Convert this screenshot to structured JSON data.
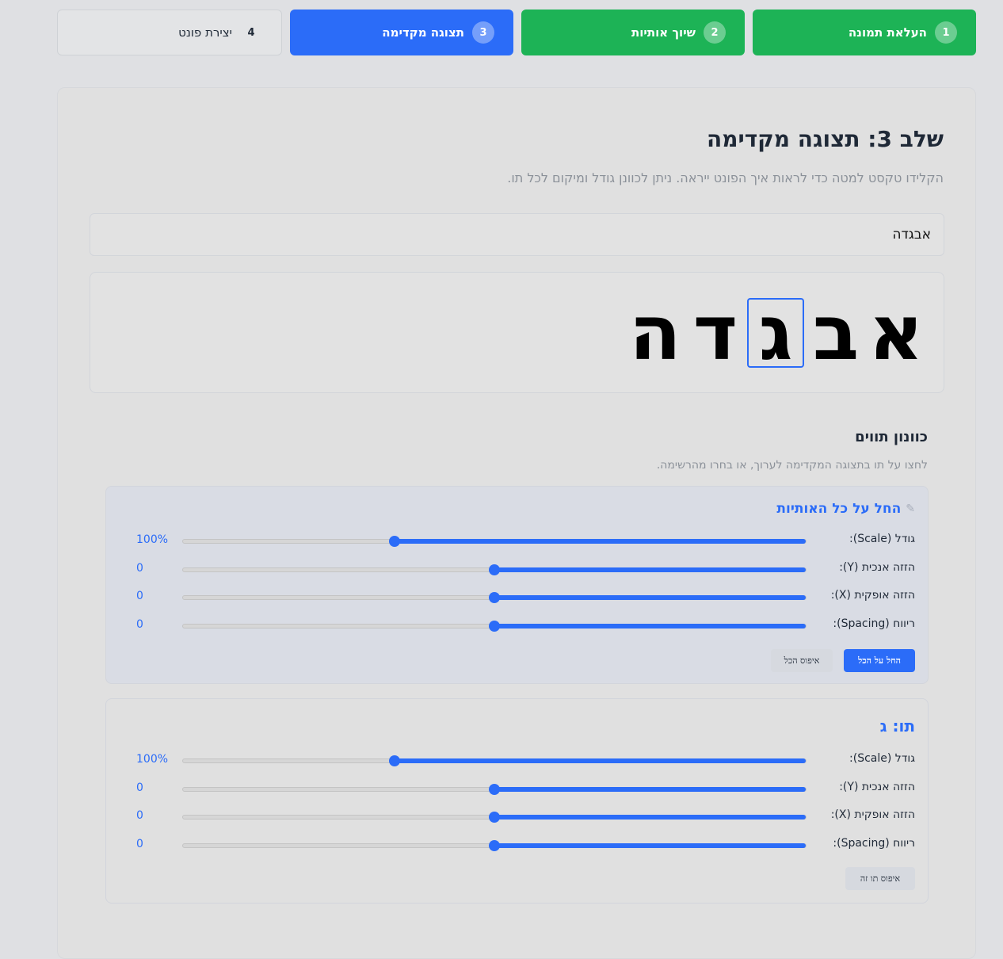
{
  "steps": [
    {
      "num": "1",
      "label": "העלאת תמונה",
      "state": "done"
    },
    {
      "num": "2",
      "label": "שיוך אותיות",
      "state": "done"
    },
    {
      "num": "3",
      "label": "תצוגה מקדימה",
      "state": "active"
    },
    {
      "num": "4",
      "label": "יצירת פונט",
      "state": "pending"
    }
  ],
  "main": {
    "title": "שלב 3: תצוגה מקדימה",
    "subtitle": "הקלידו טקסט למטה כדי לראות איך הפונט ייראה. ניתן לכוונן גודל ומיקום לכל תו.",
    "input_value": "אבגדה"
  },
  "preview": {
    "glyphs": [
      "א",
      "ב",
      "ג",
      "ד",
      "ה"
    ],
    "selected_index": 2
  },
  "tuning": {
    "title": "כוונון תווים",
    "help": "לחצו על תו בתצוגה המקדימה לערוך, או בחרו מהרשימה."
  },
  "global_panel": {
    "heading": "החל על כל האותיות",
    "icon": "magic-wand-icon",
    "rows": [
      {
        "label": "גודל (Scale):",
        "value": "100%",
        "fraction": 0.34
      },
      {
        "label": "הזזה אנכית (Y):",
        "value": "0",
        "fraction": 0.5
      },
      {
        "label": "הזזה אופקית (X):",
        "value": "0",
        "fraction": 0.5
      },
      {
        "label": "ריווח (Spacing):",
        "value": "0",
        "fraction": 0.5
      }
    ],
    "apply_label": "החל על הכל",
    "reset_label": "איפוס הכל"
  },
  "letter_panel": {
    "heading": "תו: ג",
    "rows": [
      {
        "label": "גודל (Scale):",
        "value": "100%",
        "fraction": 0.34
      },
      {
        "label": "הזזה אנכית (Y):",
        "value": "0",
        "fraction": 0.5
      },
      {
        "label": "הזזה אופקית (X):",
        "value": "0",
        "fraction": 0.5
      },
      {
        "label": "ריווח (Spacing):",
        "value": "0",
        "fraction": 0.5
      }
    ],
    "reset_label": "איפוס תו זה"
  },
  "colors": {
    "accent": "#2b6cf8",
    "success": "#1db356"
  }
}
